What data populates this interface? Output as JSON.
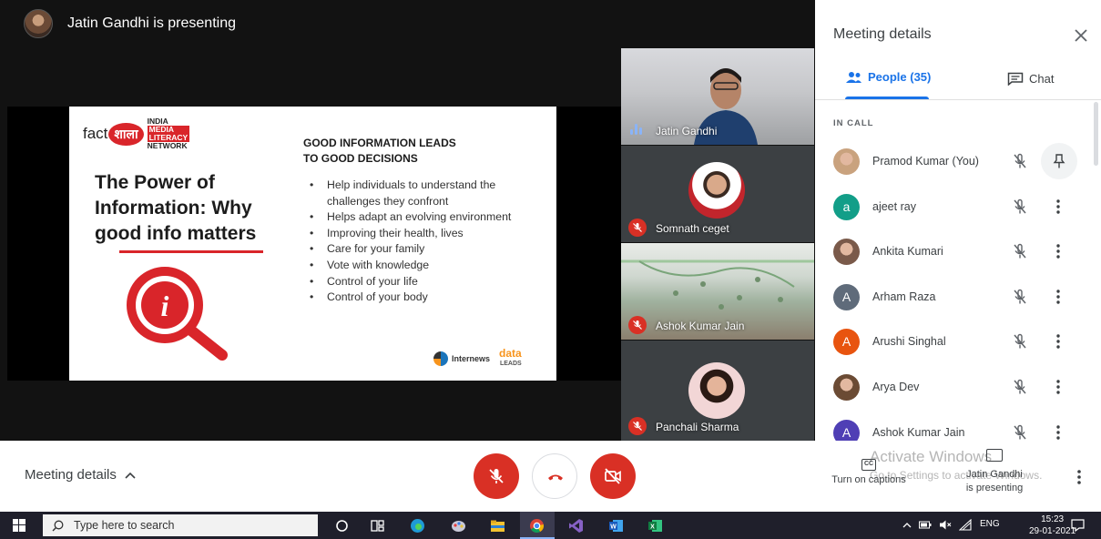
{
  "presenter_bar": {
    "text": "Jatin Gandhi is presenting"
  },
  "slide": {
    "logo_fact": "fact",
    "logo_shala": "शाला",
    "logo_network": [
      "INDIA",
      "MEDIA",
      "LITERACY",
      "NETWORK"
    ],
    "title": "The Power of Information: Why good info matters",
    "heading_line1": "GOOD INFORMATION LEADS",
    "heading_line2": "TO GOOD DECISIONS",
    "bullets": [
      "Help individuals to understand the challenges they confront",
      "Helps adapt an evolving environment",
      "Improving their health, lives",
      "Care for your family",
      "Vote with knowledge",
      "Control of your life",
      "Control of your body"
    ],
    "footer_internews": "Internews",
    "footer_data": "data",
    "footer_leads": "LEADS"
  },
  "tiles": [
    {
      "name": "Jatin Gandhi"
    },
    {
      "name": "Somnath ceget"
    },
    {
      "name": "Ashok Kumar Jain"
    },
    {
      "name": "Panchali Sharma"
    }
  ],
  "panel": {
    "title": "Meeting details",
    "tab_people": "People (35)",
    "tab_chat": "Chat",
    "section": "IN CALL",
    "participants": [
      {
        "name": "Pramod Kumar (You)",
        "initial": "",
        "color": "#c9a27e"
      },
      {
        "name": "ajeet ray",
        "initial": "a",
        "color": "#129e88"
      },
      {
        "name": "Ankita Kumari",
        "initial": "",
        "color": "#7a5a4a"
      },
      {
        "name": "Arham Raza",
        "initial": "A",
        "color": "#5f6b7a"
      },
      {
        "name": "Arushi Singhal",
        "initial": "A",
        "color": "#e8540f"
      },
      {
        "name": "Arya Dev",
        "initial": "",
        "color": "#6b4b34"
      },
      {
        "name": "Ashok Kumar Jain",
        "initial": "A",
        "color": "#4f3fb5"
      }
    ]
  },
  "bottom": {
    "meeting_details": "Meeting details",
    "captions_icon": "CC",
    "captions": "Turn on captions",
    "presenting_line1": "Jatin Gandhi",
    "presenting_line2": "is presenting",
    "watermark_line1": "Activate Windows",
    "watermark_line2": "Go to Settings to activate Windows."
  },
  "taskbar": {
    "search_placeholder": "Type here to search",
    "lang": "ENG",
    "time": "15:23",
    "date": "29-01-2021"
  },
  "colors": {
    "accent": "#1a73e8",
    "danger": "#d93025"
  }
}
